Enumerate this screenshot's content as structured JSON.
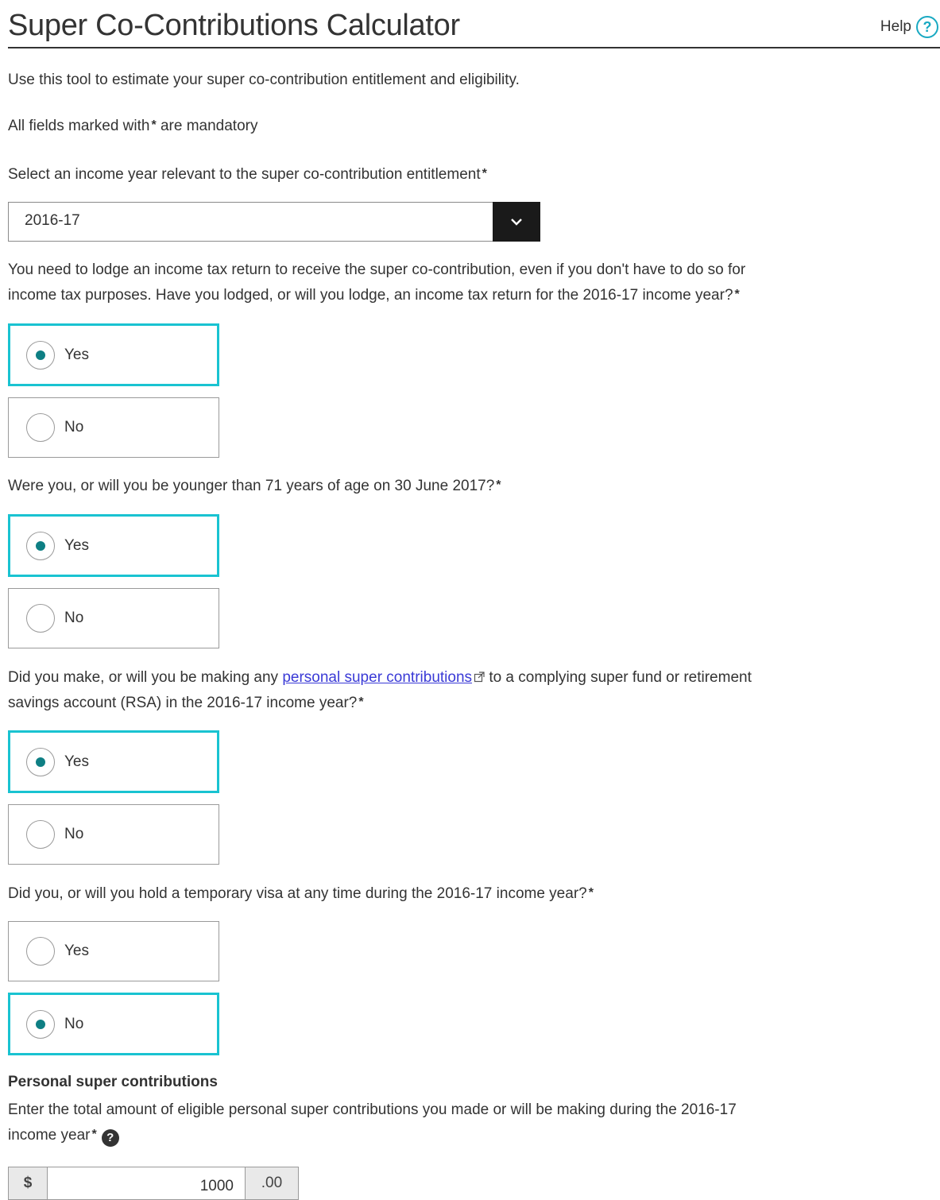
{
  "header": {
    "title": "Super Co-Contributions Calculator",
    "help_label": "Help",
    "help_icon_glyph": "?"
  },
  "intro": "Use this tool to estimate your super co-contribution entitlement and eligibility.",
  "mandatory_note": {
    "before": "All fields marked with",
    "after": "are mandatory"
  },
  "required_marker": "*",
  "income_year": {
    "label": "Select an income year relevant to the super co-contribution entitlement",
    "selected": "2016-17"
  },
  "q1": {
    "line1": "You need to lodge an income tax return to receive the super co-contribution, even if you don't have to do so for",
    "line2": "income tax purposes. Have you lodged, or will you lodge, an income tax return for the 2016-17 income year?",
    "options": [
      "Yes",
      "No"
    ],
    "selected": "Yes"
  },
  "q2": {
    "text": "Were you, or will you be younger than 71 years of age on 30 June 2017?",
    "options": [
      "Yes",
      "No"
    ],
    "selected": "Yes"
  },
  "q3": {
    "line1_before": "Did you make, or will you be making any",
    "link": "personal super contributions",
    "line1_after": "to a complying super fund or retirement",
    "line2": "savings account (RSA) in the 2016-17 income year?",
    "options": [
      "Yes",
      "No"
    ],
    "selected": "Yes"
  },
  "q4": {
    "text": "Did you, or will you hold a temporary visa at any time during the 2016-17 income year?",
    "options": [
      "Yes",
      "No"
    ],
    "selected": "No"
  },
  "contributions": {
    "heading": "Personal super contributions",
    "line1": "Enter the total amount of eligible personal super contributions you made or will be making during the 2016-17",
    "line2": "income year",
    "info_glyph": "?",
    "currency": "$",
    "value": "1000",
    "cents": ".00"
  },
  "colors": {
    "selected_border": "#19c3d1",
    "radio_dot": "#0e7f84",
    "link": "#3a3ad6"
  }
}
